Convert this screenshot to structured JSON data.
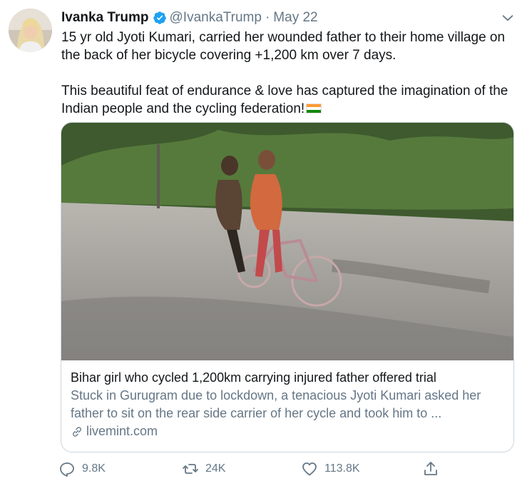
{
  "author": {
    "name": "Ivanka Trump",
    "handle": "@IvankaTrump",
    "separator": "·",
    "date": "May 22"
  },
  "tweet": {
    "paragraph1": "15 yr old Jyoti Kumari, carried her wounded father to their home village on the back of her bicycle covering +1,200 km over 7 days.",
    "paragraph2": "This beautiful feat of endurance & love has captured the imagination of the Indian people and the cycling federation!",
    "flag_icon": "india-flag-icon"
  },
  "card": {
    "title": "Bihar girl who cycled 1,200km carrying injured father offered trial",
    "description": "Stuck in Gurugram due to lockdown, a tenacious Jyoti Kumari asked her father to sit on the rear side carrier of her cycle and took him to ...",
    "domain": "livemint.com",
    "link_icon": "link-icon"
  },
  "actions": {
    "reply_count": "9.8K",
    "retweet_count": "24K",
    "like_count": "113.8K"
  },
  "colors": {
    "text": "#14171a",
    "muted": "#657786",
    "verified": "#1da1f2",
    "border": "#ccd6dd"
  }
}
